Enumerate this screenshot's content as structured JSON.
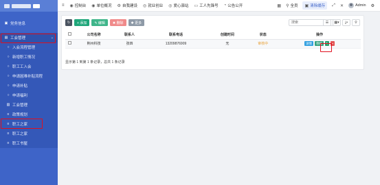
{
  "sidebar": {
    "items": [
      {
        "label": "党务信息",
        "icon": "dashboard-icon",
        "glyph": "▣"
      },
      {
        "label": "工会管理",
        "icon": "union-icon",
        "glyph": "▤",
        "parent": true
      },
      {
        "label": "入会流程管理",
        "icon": "circle-icon",
        "glyph": "○",
        "sub": true
      },
      {
        "label": "新增职工情况",
        "icon": "circle-icon",
        "glyph": "○",
        "sub": true
      },
      {
        "label": "职工工入会",
        "icon": "circle-icon",
        "glyph": "○",
        "sub": true
      },
      {
        "label": "申请困难补贴流程",
        "icon": "circle-icon",
        "glyph": "○",
        "sub": true
      },
      {
        "label": "申请补贴",
        "icon": "circle-icon",
        "glyph": "○",
        "sub": true
      },
      {
        "label": "申请福利",
        "icon": "circle-icon",
        "glyph": "○",
        "sub": true
      },
      {
        "label": "工会管理",
        "icon": "book-icon",
        "glyph": "▥",
        "sub": true,
        "highlight": true
      },
      {
        "label": "政策规划",
        "icon": "list-icon",
        "glyph": "≡",
        "sub": true
      },
      {
        "label": "职工之家",
        "icon": "list-icon",
        "glyph": "≡",
        "sub": true
      },
      {
        "label": "职工之家",
        "icon": "list-icon",
        "glyph": "≡",
        "sub": true
      },
      {
        "label": "职工书屋",
        "icon": "list-icon",
        "glyph": "≡",
        "sub": true
      }
    ]
  },
  "topbar": {
    "items": [
      {
        "label": "",
        "icon": "menu-toggle-icon",
        "glyph": "≡"
      },
      {
        "label": "控制台",
        "icon": "dashboard-icon",
        "glyph": "◉"
      },
      {
        "label": "单位概况",
        "icon": "building-icon",
        "glyph": "◉"
      },
      {
        "label": "自我建设",
        "icon": "gear-icon",
        "glyph": "⚙"
      },
      {
        "label": "就业创业",
        "icon": "globe-icon",
        "glyph": "◎"
      },
      {
        "label": "爱心驿站",
        "icon": "heart-icon",
        "glyph": "◎"
      },
      {
        "label": "工人先锋号",
        "icon": "id-card-icon",
        "glyph": "▭"
      },
      {
        "label": "公告公开",
        "icon": "bell-icon",
        "glyph": "◔"
      }
    ],
    "right": [
      {
        "label": "",
        "icon": "grid-icon",
        "glyph": "▦"
      },
      {
        "label": "全员",
        "icon": "user-icon",
        "glyph": "⚲"
      },
      {
        "label": "清除缓存",
        "icon": "trash-icon",
        "glyph": "▣"
      },
      {
        "label": "",
        "icon": "expand-icon",
        "glyph": "⤢"
      },
      {
        "label": "",
        "icon": "fullscreen-icon",
        "glyph": "✕"
      }
    ],
    "user": "Admin"
  },
  "toolbar": {
    "refresh": "↻",
    "add": "+ 添加",
    "edit": "✎ 编辑",
    "delete": "✖ 删除",
    "more": "✱ 更多",
    "search_placeholder": "搜索"
  },
  "table": {
    "headers": [
      "",
      "公司名称",
      "联系人",
      "联系电话",
      "创建时间",
      "状态",
      "操作"
    ],
    "rows": [
      {
        "company": "荆州科技",
        "contact": "张四",
        "phone": "13209876909",
        "created": "无",
        "status": "审核中"
      }
    ],
    "ops": {
      "detail": "详情",
      "audit": "审核"
    }
  },
  "footer": "显示第 1 到第 1 条记录，总共 1 条记录",
  "colors": {
    "sidebar": "#3e64c8",
    "highlight": "#e0101e",
    "status": "#e8a33d"
  }
}
